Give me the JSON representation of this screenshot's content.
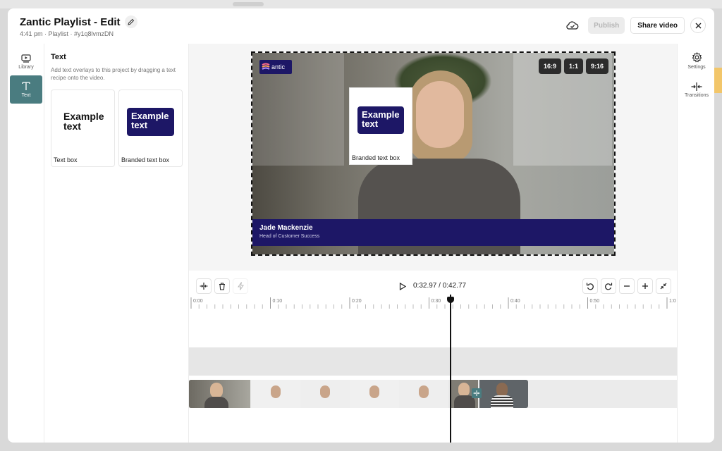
{
  "header": {
    "title": "Zantic Playlist - Edit",
    "subtitle": "4:41 pm · Playlist · #y1q8lvmzDN",
    "publish_label": "Publish",
    "share_label": "Share video"
  },
  "left_rail": {
    "items": [
      {
        "label": "Library",
        "icon": "library-icon",
        "active": false
      },
      {
        "label": "Text",
        "icon": "text-icon",
        "active": true
      }
    ]
  },
  "text_panel": {
    "title": "Text",
    "description": "Add text overlays to this project by dragging a text recipe onto the video.",
    "cards": [
      {
        "sample": "Example text",
        "label": "Text box",
        "style": "plain"
      },
      {
        "sample": "Example text",
        "label": "Branded text box",
        "style": "branded"
      }
    ]
  },
  "preview": {
    "logo_text": "antic",
    "overlay": {
      "sample": "Example text",
      "label": "Branded text box"
    },
    "lower_third": {
      "name": "Jade Mackenzie",
      "role": "Head of Customer Success"
    },
    "aspect_ratios": [
      "16:9",
      "1:1",
      "9:16"
    ]
  },
  "player": {
    "current_time": "0:32.97",
    "duration": "0:42.77",
    "time_display": "0:32.97 / 0:42.77"
  },
  "timeline": {
    "ticks": [
      "0:00",
      "0:10",
      "0:20",
      "0:30",
      "0:40",
      "0:50",
      "1:0"
    ],
    "playhead_time": "0:32.97"
  },
  "right_rail": {
    "items": [
      {
        "label": "Settings",
        "icon": "gear-icon"
      },
      {
        "label": "Transitions",
        "icon": "transitions-icon"
      }
    ]
  },
  "colors": {
    "brand_navy": "#1d1766",
    "active_teal": "#4a7c80",
    "accent_yellow": "#f2c66a"
  }
}
